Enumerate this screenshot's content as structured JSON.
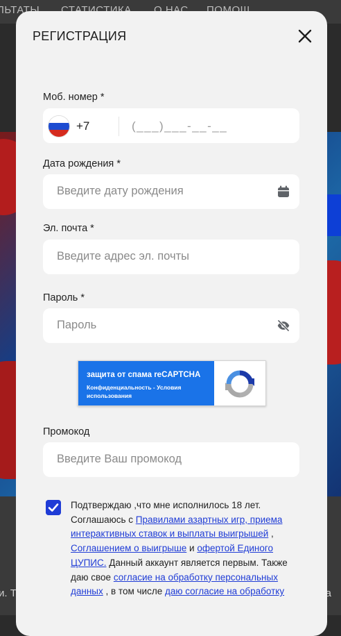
{
  "background": {
    "nav_items": [
      "ЛЬТАТЫ",
      "СТАТИСТИКА",
      "О НАС",
      "ПОМОЩ"
    ],
    "bottom_left_text": "и. Т",
    "bottom_right_text": "а"
  },
  "modal": {
    "title": "РЕГИСТРАЦИЯ"
  },
  "phone": {
    "label": "Моб. номер *",
    "country_code": "+7",
    "mask_placeholder": "(___)___-__-__"
  },
  "birthdate": {
    "label": "Дата рождения *",
    "placeholder": "Введите дату рождения"
  },
  "email": {
    "label": "Эл. почта *",
    "placeholder": "Введите адрес эл. почты"
  },
  "password": {
    "label": "Пароль *",
    "placeholder": "Пароль"
  },
  "captcha": {
    "title": "защита от спама reCAPTCHA",
    "links": "Конфиденциальность - Условия использования"
  },
  "promo": {
    "label": "Промокод",
    "placeholder": "Введите Ваш промокод"
  },
  "consent": {
    "checked": true,
    "t1": "Подтверждаю ,что мне исполнилось 18 лет. Соглашаюсь с ",
    "link1": "Правилами азартных игр, приема интерактивных ставок и выплаты выигрышей",
    "t2": " , ",
    "link2": "Соглашением о выигрыше",
    "t3": "  и ",
    "link3": "офертой Единого ЦУПИС.",
    "t4": " Данный аккаунт является первым. Также даю свое ",
    "link4": "согласие на обработку персональных данных",
    "t5": " , в том числе ",
    "link5": "даю согласие на обработку"
  }
}
